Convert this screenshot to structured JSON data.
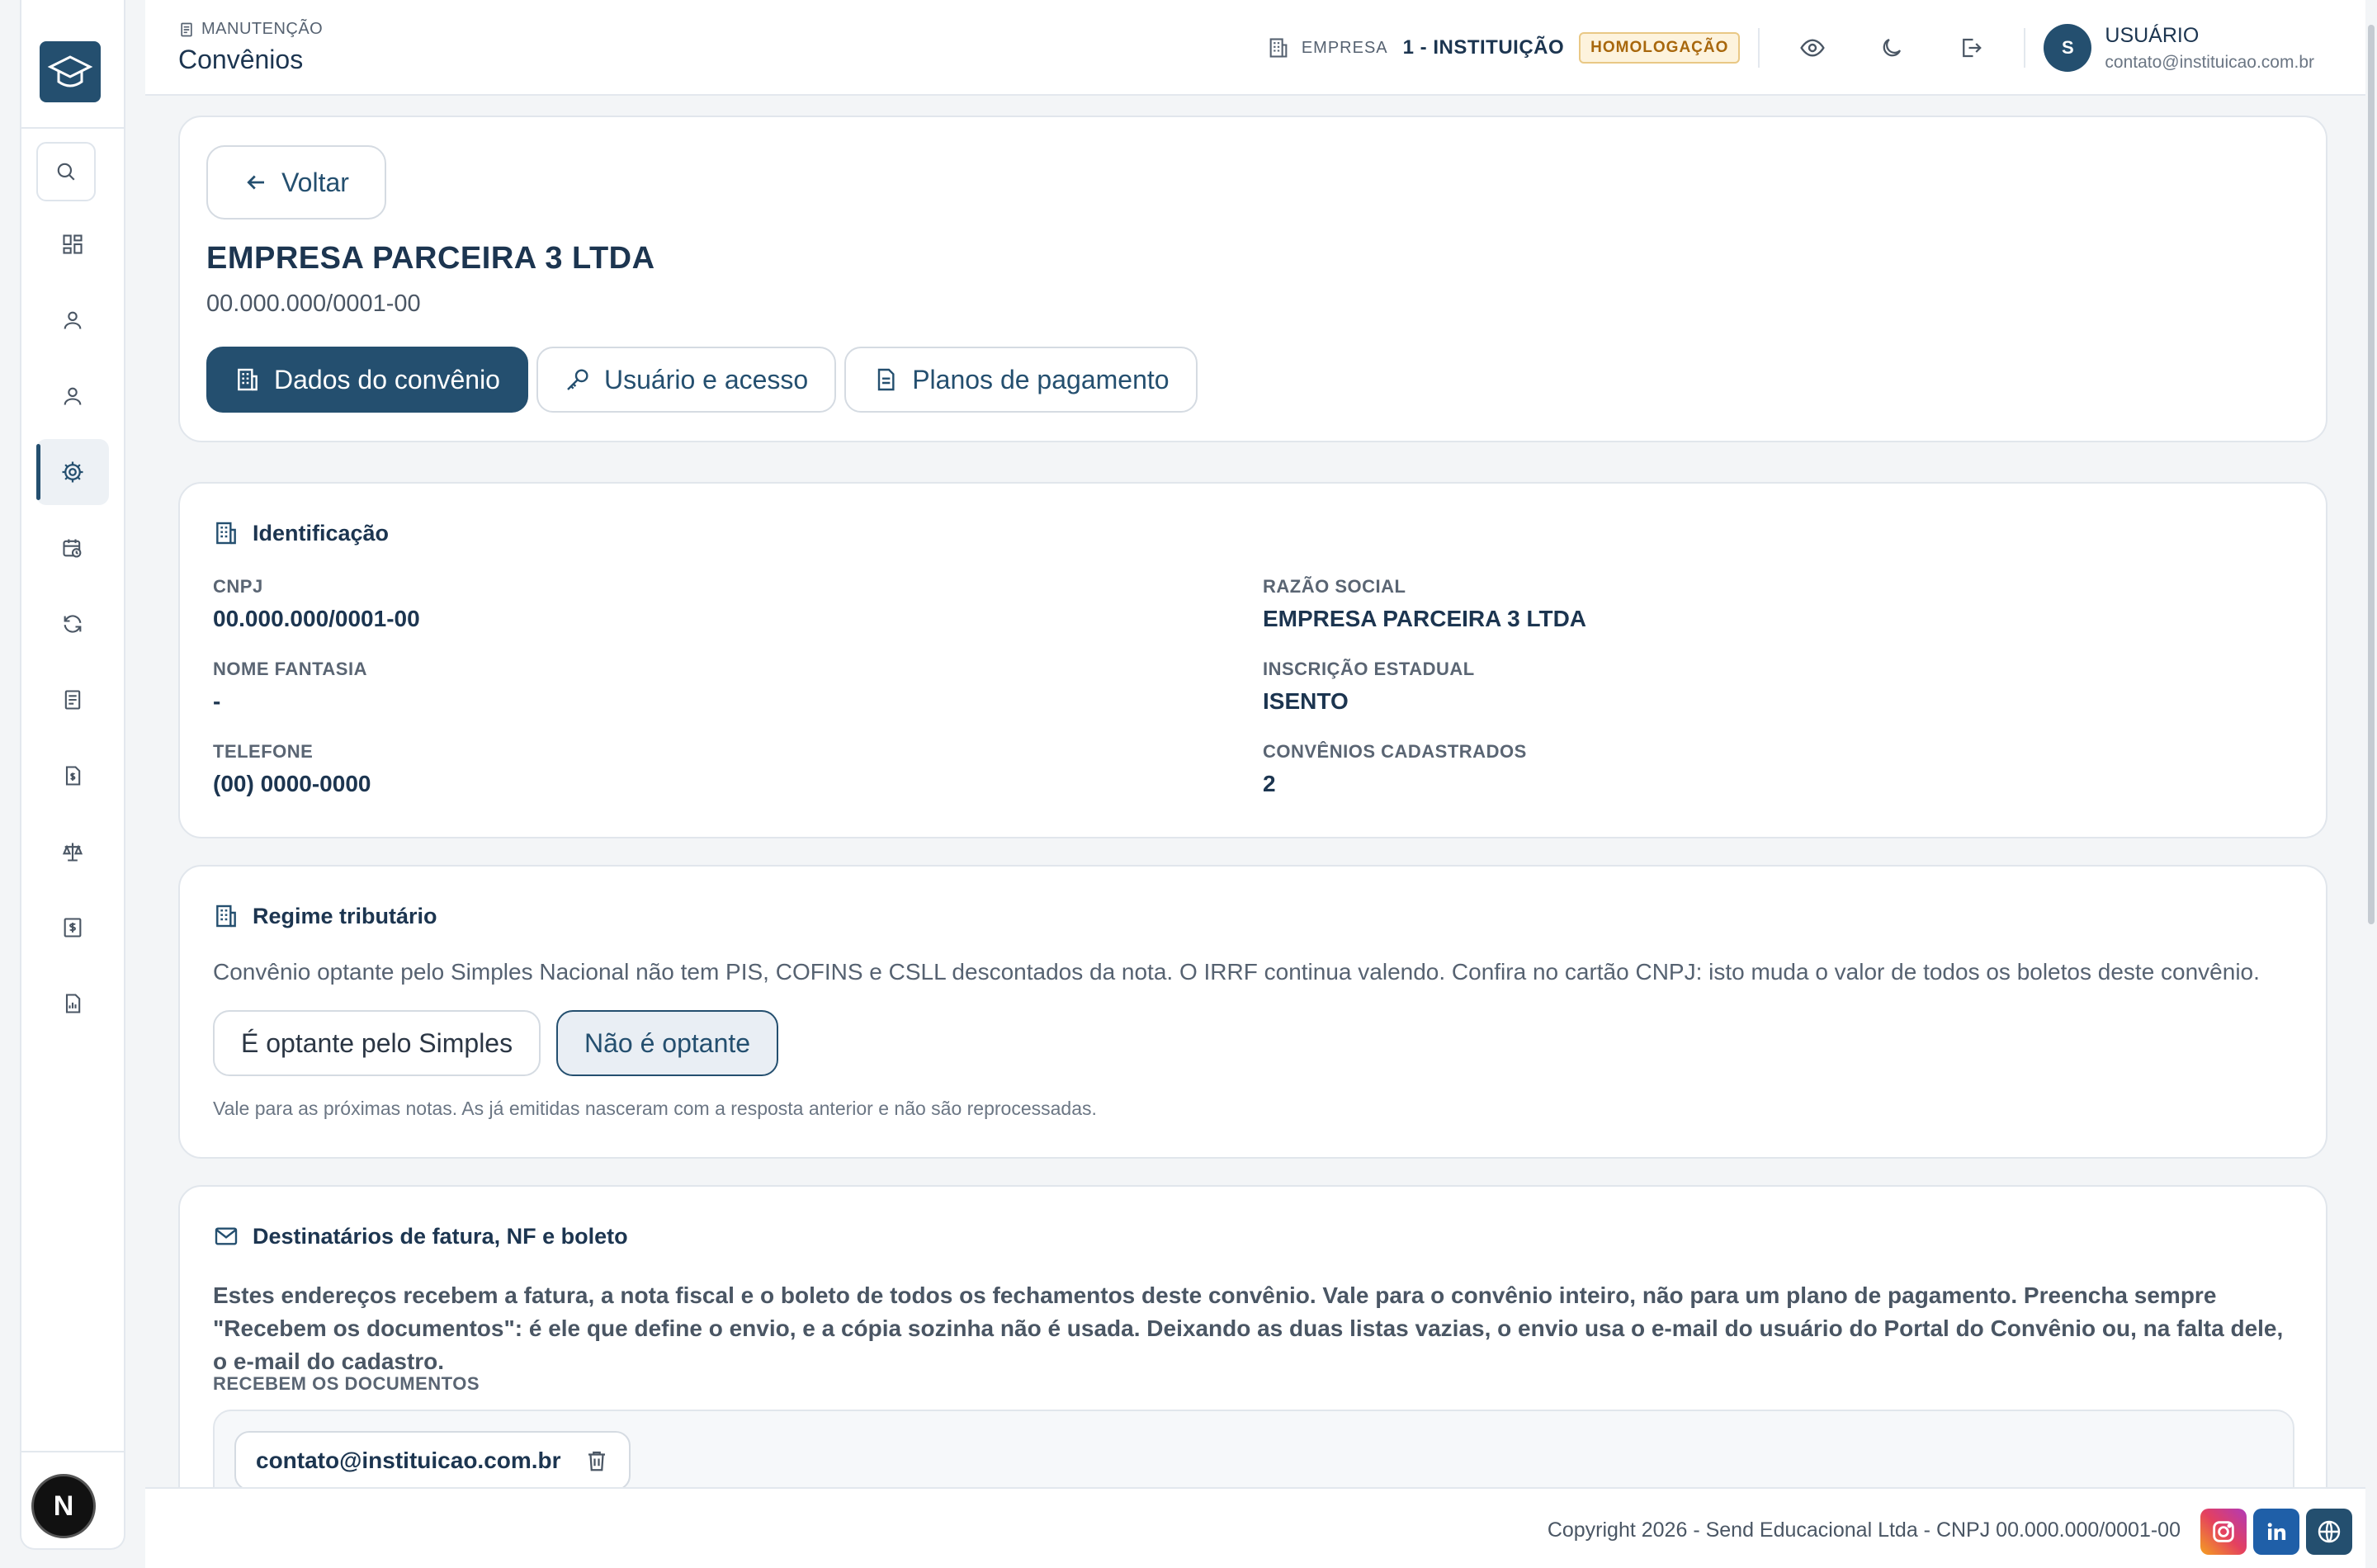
{
  "header": {
    "breadcrumb": "MANUTENÇÃO",
    "title": "Convênios",
    "company_label": "EMPRESA",
    "company_value": "1 - INSTITUIÇÃO",
    "environment_badge": "HOMOLOGAÇÃO",
    "user": {
      "initial": "S",
      "name": "USUÁRIO",
      "email": "contato@instituicao.com.br"
    }
  },
  "sidebar": {
    "items": [
      {
        "icon": "search-icon"
      },
      {
        "icon": "dashboard-grid-icon"
      },
      {
        "icon": "user-icon"
      },
      {
        "icon": "user-icon"
      },
      {
        "icon": "gear-icon",
        "active": true
      },
      {
        "icon": "calendar-clock-icon"
      },
      {
        "icon": "refresh-icon"
      },
      {
        "icon": "document-list-icon"
      },
      {
        "icon": "document-dollar-icon"
      },
      {
        "icon": "scale-icon"
      },
      {
        "icon": "receipt-dollar-icon"
      },
      {
        "icon": "report-chart-icon"
      }
    ],
    "bottom_badge": "N"
  },
  "top_card": {
    "back_label": "Voltar",
    "company_name": "EMPRESA PARCEIRA 3 LTDA",
    "company_cnpj": "00.000.000/0001-00",
    "tabs": [
      {
        "label": "Dados do convênio",
        "icon": "building-icon",
        "active": true
      },
      {
        "label": "Usuário e acesso",
        "icon": "key-icon",
        "active": false
      },
      {
        "label": "Planos de pagamento",
        "icon": "document-icon",
        "active": false
      }
    ]
  },
  "identificacao": {
    "title": "Identificação",
    "fields": {
      "cnpj": {
        "label": "CNPJ",
        "value": "00.000.000/0001-00"
      },
      "razao_social": {
        "label": "RAZÃO SOCIAL",
        "value": "EMPRESA PARCEIRA 3 LTDA"
      },
      "nome_fantasia": {
        "label": "NOME FANTASIA",
        "value": "-"
      },
      "inscricao_estadual": {
        "label": "INSCRIÇÃO ESTADUAL",
        "value": "ISENTO"
      },
      "telefone": {
        "label": "TELEFONE",
        "value": "(00) 0000-0000"
      },
      "convenios_cadastrados": {
        "label": "CONVÊNIOS CADASTRADOS",
        "value": "2"
      }
    }
  },
  "regime": {
    "title": "Regime tributário",
    "description": "Convênio optante pelo Simples Nacional não tem PIS, COFINS e CSLL descontados da nota. O IRRF continua valendo. Confira no cartão CNPJ: isto muda o valor de todos os boletos deste convênio.",
    "option_yes": "É optante pelo Simples",
    "option_no": "Não é optante",
    "selected": "option_no",
    "note": "Vale para as próximas notas. As já emitidas nasceram com a resposta anterior e não são reprocessadas."
  },
  "destinatarios": {
    "title": "Destinatários de fatura, NF e boleto",
    "description": "Estes endereços recebem a fatura, a nota fiscal e o boleto de todos os fechamentos deste convênio. Vale para o convênio inteiro, não para um plano de pagamento. Preencha sempre \"Recebem os documentos\": é ele que define o envio, e a cópia sozinha não é usada. Deixando as duas listas vazias, o envio usa o e-mail do usuário do Portal do Convênio ou, na falta dele, o e-mail do cadastro.",
    "list_label": "RECEBEM OS DOCUMENTOS",
    "emails": [
      "contato@instituicao.com.br"
    ]
  },
  "footer": {
    "copyright": "Copyright 2026 - Send Educacional Ltda - CNPJ 00.000.000/0001-00",
    "social": [
      "instagram-icon",
      "linkedin-icon",
      "globe-icon"
    ]
  },
  "colors": {
    "primary": "#244f6f",
    "badge_text": "#a8670c",
    "badge_bg": "#fdf3dd"
  }
}
